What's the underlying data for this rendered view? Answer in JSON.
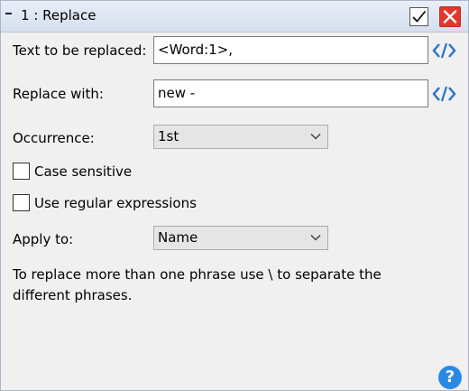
{
  "window": {
    "title": "1 : Replace"
  },
  "fields": {
    "text_to_replace": {
      "label": "Text to be replaced:",
      "value": "<Word:1>,"
    },
    "replace_with": {
      "label": "Replace with:",
      "value": "new -"
    }
  },
  "occurrence": {
    "label": "Occurrence:",
    "selected": "1st"
  },
  "options": {
    "case_sensitive": {
      "label": "Case sensitive",
      "checked": false
    },
    "regex": {
      "label": "Use regular expressions",
      "checked": false
    }
  },
  "apply_to": {
    "label": "Apply to:",
    "selected": "Name"
  },
  "hint": "To replace more than one phrase use \\ to separate the different phrases.",
  "help": {
    "label": "?"
  },
  "colors": {
    "accent": "#2a8ae3",
    "close": "#e3372c"
  },
  "icons": [
    "collapse-icon",
    "checkmark-icon",
    "close-icon",
    "code-icon",
    "chevron-down-icon",
    "help-icon"
  ]
}
